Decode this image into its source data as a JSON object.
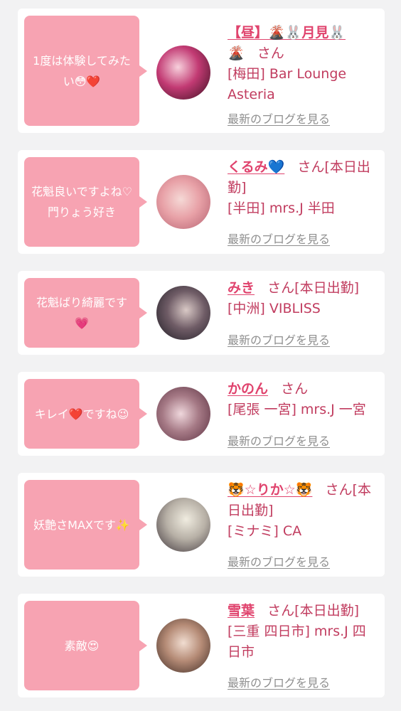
{
  "items": [
    {
      "comment": "1度は体験してみたい😳❤️",
      "name": "【昼】🌋🐰月見🐰",
      "name_tail": "🌋",
      "san": "さん",
      "suffix": "",
      "shop": "[梅田] Bar Lounge Asteria",
      "blog_link": "最新のブログを見る",
      "avatar_colors": [
        "#3a1020",
        "#c23a73",
        "#f7d0dc"
      ]
    },
    {
      "comment": "花魁良いですよね♡門りょう好き",
      "name": "くるみ💙",
      "name_tail": "",
      "san": "さん",
      "suffix": "[本日出勤]",
      "shop": "[半田] mrs.J 半田",
      "blog_link": "最新のブログを見る",
      "avatar_colors": [
        "#b46170",
        "#e8a1a7",
        "#f5d9d6"
      ]
    },
    {
      "comment": "花魁ばり綺麗です💗",
      "name": "みき",
      "name_tail": "",
      "san": "さん",
      "suffix": "[本日出勤]",
      "shop": "[中洲] VIBLISS",
      "blog_link": "最新のブログを見る",
      "avatar_colors": [
        "#1c1a22",
        "#6f5c66",
        "#d9c9c6"
      ]
    },
    {
      "comment": "キレイ❤️ですね😉",
      "name": "かのん",
      "name_tail": "",
      "san": "さん",
      "suffix": "",
      "shop": "[尾張 一宮] mrs.J 一宮",
      "blog_link": "最新のブログを見る",
      "avatar_colors": [
        "#5a3040",
        "#a67a86",
        "#efd7dc"
      ]
    },
    {
      "comment": "妖艶さMAXです✨",
      "name": "🐯☆りか☆🐯",
      "name_tail": "",
      "san": "さん",
      "suffix": "[本日出勤]",
      "shop": "[ミナミ] CA",
      "blog_link": "最新のブログを見る",
      "avatar_colors": [
        "#3b3238",
        "#b7b0a6",
        "#f0ece0"
      ]
    },
    {
      "comment": "素敵😍",
      "name": "雪葉",
      "name_tail": "",
      "san": "さん",
      "suffix": "[本日出勤]",
      "shop": "[三重 四日市] mrs.J 四日市",
      "blog_link": "最新のブログを見る",
      "avatar_colors": [
        "#3f2b24",
        "#b58b76",
        "#f1ddd1"
      ]
    }
  ]
}
